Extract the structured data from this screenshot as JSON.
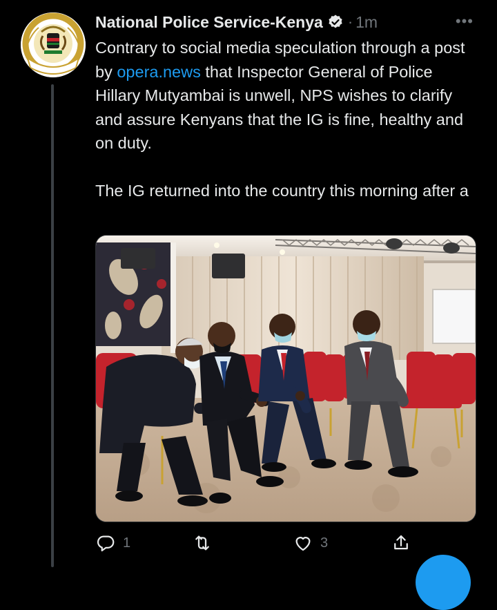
{
  "tweet": {
    "author_name": "National Police Service-Kenya",
    "separator": "·",
    "time": "1m",
    "more_label": "•••",
    "text_before_link": "Contrary to social media speculation through a post by ",
    "link_text": "opera.news",
    "text_after_link": " that Inspector General of Police Hillary Mutyambai is unwell, NPS wishes to clarify and assure Kenyans that the IG is fine, healthy and on duty.",
    "text_paragraph_2": "The IG returned into the country this morning after a",
    "avatar_seal_text": "NATIONAL POLICE SERVICE"
  },
  "actions": {
    "reply_count": "1",
    "retweet_count": "",
    "like_count": "3"
  },
  "colors": {
    "background": "#000000",
    "primary_text": "#e7e9ea",
    "secondary_text": "#71767b",
    "link": "#1d9bf0",
    "chair_red": "#c4232c"
  },
  "icons": [
    "verified-badge-icon",
    "more-options-icon",
    "reply-icon",
    "retweet-icon",
    "like-icon",
    "share-icon"
  ]
}
